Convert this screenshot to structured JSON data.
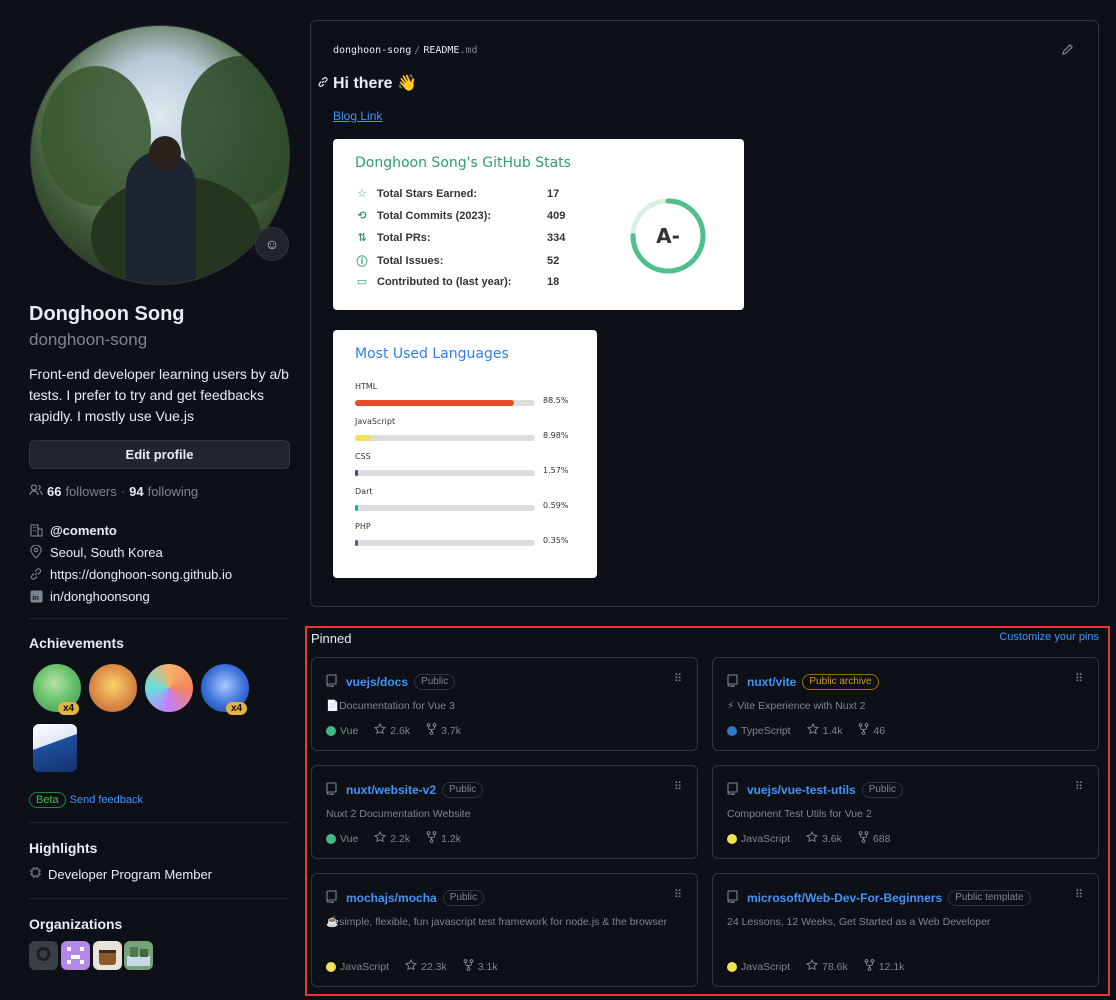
{
  "profile": {
    "name": "Donghoon Song",
    "login": "donghoon-song",
    "bio": "Front-end developer learning users by a/b tests. I prefer to try and get feedbacks rapidly. I mostly use Vue.js",
    "edit_label": "Edit profile",
    "followers_count": "66",
    "followers_label": "followers",
    "following_count": "94",
    "following_label": "following",
    "separator": "·",
    "company": "@comento",
    "location": "Seoul, South Korea",
    "website": "https://donghoon-song.github.io",
    "linkedin": "in/donghoonsong"
  },
  "achievements": {
    "title": "Achievements",
    "badges": [
      {
        "icon": "pair-extraordinaire-icon",
        "count": "x4"
      },
      {
        "icon": "quickdraw-icon",
        "count": ""
      },
      {
        "icon": "yolo-icon",
        "count": ""
      },
      {
        "icon": "pull-shark-icon",
        "count": "x4"
      },
      {
        "icon": "arctic-code-vault-icon",
        "count": ""
      }
    ],
    "beta_label": "Beta",
    "feedback_label": "Send feedback"
  },
  "highlights": {
    "title": "Highlights",
    "item": "Developer Program Member"
  },
  "organizations": {
    "title": "Organizations",
    "count": 4
  },
  "readme": {
    "owner": "donghoon-song",
    "path_sep": "/",
    "file": "README",
    "ext": ".md",
    "heading": "Hi there 👋",
    "blog_link": "Blog Link",
    "stats": {
      "title": "Donghoon Song's GitHub Stats",
      "rows": [
        {
          "label": "Total Stars Earned:",
          "value": "17",
          "icon": "star-icon"
        },
        {
          "label": "Total Commits (2023):",
          "value": "409",
          "icon": "history-icon"
        },
        {
          "label": "Total PRs:",
          "value": "334",
          "icon": "pull-request-icon"
        },
        {
          "label": "Total Issues:",
          "value": "52",
          "icon": "issue-icon"
        },
        {
          "label": "Contributed to (last year):",
          "value": "18",
          "icon": "repo-icon"
        }
      ],
      "grade": "A-",
      "accent": "#2f9e6b"
    },
    "languages": {
      "title": "Most Used Languages",
      "items": [
        {
          "name": "HTML",
          "percent": "88.5%",
          "value": 88.5,
          "color": "#e34c26"
        },
        {
          "name": "JavaScript",
          "percent": "8.98%",
          "value": 8.98,
          "color": "#f1e05a"
        },
        {
          "name": "CSS",
          "percent": "1.57%",
          "value": 1.57,
          "color": "#563d7c"
        },
        {
          "name": "Dart",
          "percent": "0.59%",
          "value": 0.59,
          "color": "#00B4AB"
        },
        {
          "name": "PHP",
          "percent": "0.35%",
          "value": 0.35,
          "color": "#4F5D95"
        }
      ]
    }
  },
  "pinned": {
    "title": "Pinned",
    "customize_label": "Customize your pins",
    "repos": [
      {
        "name": "vuejs/docs",
        "visibility": "Public",
        "archive": false,
        "description": "📄Documentation for Vue 3",
        "language": "Vue",
        "lang_color": "#41b883",
        "stars": "2.6k",
        "forks": "3.7k"
      },
      {
        "name": "nuxt/vite",
        "visibility": "Public archive",
        "archive": true,
        "description": "⚡ Vite Experience with Nuxt 2",
        "language": "TypeScript",
        "lang_color": "#3178c6",
        "stars": "1.4k",
        "forks": "46"
      },
      {
        "name": "nuxt/website-v2",
        "visibility": "Public",
        "archive": false,
        "description": "Nuxt 2 Documentation Website",
        "language": "Vue",
        "lang_color": "#41b883",
        "stars": "2.2k",
        "forks": "1.2k"
      },
      {
        "name": "vuejs/vue-test-utils",
        "visibility": "Public",
        "archive": false,
        "description": "Component Test Utils for Vue 2",
        "language": "JavaScript",
        "lang_color": "#f1e05a",
        "stars": "3.6k",
        "forks": "688"
      },
      {
        "name": "mochajs/mocha",
        "visibility": "Public",
        "archive": false,
        "description": "☕️simple, flexible, fun javascript test framework for node.js & the browser",
        "language": "JavaScript",
        "lang_color": "#f1e05a",
        "stars": "22.3k",
        "forks": "3.1k"
      },
      {
        "name": "microsoft/Web-Dev-For-Beginners",
        "visibility": "Public template",
        "archive": false,
        "description": "24 Lessons, 12 Weeks, Get Started as a Web Developer",
        "language": "JavaScript",
        "lang_color": "#f1e05a",
        "stars": "78.6k",
        "forks": "12.1k"
      }
    ]
  }
}
